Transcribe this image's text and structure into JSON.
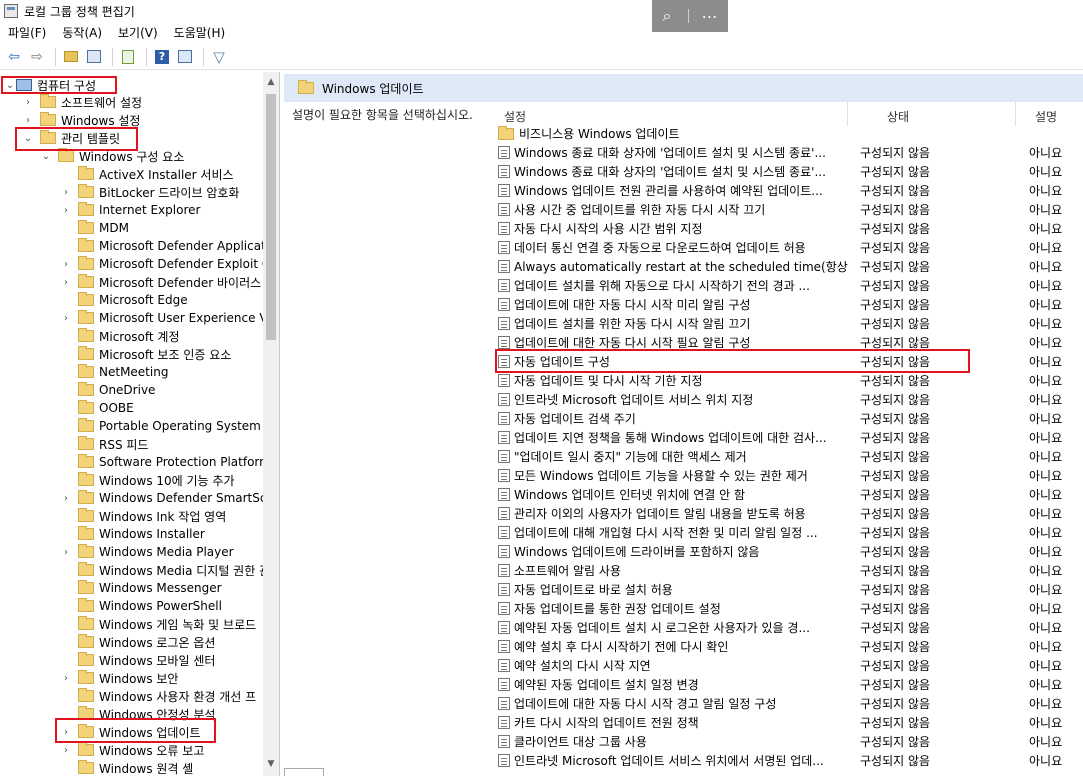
{
  "window": {
    "title": "로컬 그룹 정책 편집기"
  },
  "menu": [
    "파일(F)",
    "동작(A)",
    "보기(V)",
    "도움말(H)"
  ],
  "toolbar": {
    "icons": [
      "back-arrow-icon",
      "forward-arrow-icon",
      "up-folder-icon",
      "show-hide-tree-icon",
      "export-list-icon",
      "help-icon",
      "properties-icon",
      "filter-icon"
    ]
  },
  "tree": {
    "root": "컴퓨터 구성",
    "software_settings": "소프트웨어 설정",
    "windows_settings": "Windows 설정",
    "admin_templates": "관리 템플릿",
    "windows_components": "Windows 구성 요소",
    "items": [
      {
        "label": "ActiveX Installer 서비스",
        "expandable": false
      },
      {
        "label": "BitLocker 드라이브 암호화",
        "expandable": true
      },
      {
        "label": "Internet Explorer",
        "expandable": true
      },
      {
        "label": "MDM",
        "expandable": false
      },
      {
        "label": "Microsoft Defender Applicatio",
        "expandable": false
      },
      {
        "label": "Microsoft Defender Exploit Gu",
        "expandable": true
      },
      {
        "label": "Microsoft Defender 바이러스 ",
        "expandable": true
      },
      {
        "label": "Microsoft Edge",
        "expandable": false
      },
      {
        "label": "Microsoft User Experience Virt",
        "expandable": true
      },
      {
        "label": "Microsoft 계정",
        "expandable": false
      },
      {
        "label": "Microsoft 보조 인증 요소",
        "expandable": false
      },
      {
        "label": "NetMeeting",
        "expandable": false
      },
      {
        "label": "OneDrive",
        "expandable": false
      },
      {
        "label": "OOBE",
        "expandable": false
      },
      {
        "label": "Portable Operating System",
        "expandable": false
      },
      {
        "label": "RSS 피드",
        "expandable": false
      },
      {
        "label": "Software Protection Platform",
        "expandable": false
      },
      {
        "label": "Windows 10에 기능 추가",
        "expandable": false
      },
      {
        "label": "Windows Defender SmartScre",
        "expandable": true
      },
      {
        "label": "Windows Ink 작업 영역",
        "expandable": false
      },
      {
        "label": "Windows Installer",
        "expandable": false
      },
      {
        "label": "Windows Media Player",
        "expandable": true
      },
      {
        "label": "Windows Media 디지털 권한 관",
        "expandable": false
      },
      {
        "label": "Windows Messenger",
        "expandable": false
      },
      {
        "label": "Windows PowerShell",
        "expandable": false
      },
      {
        "label": "Windows 게임 녹화 및 브로드",
        "expandable": false
      },
      {
        "label": "Windows 로그온 옵션",
        "expandable": false
      },
      {
        "label": "Windows 모바일 센터",
        "expandable": false
      },
      {
        "label": "Windows 보안",
        "expandable": true
      },
      {
        "label": "Windows 사용자 환경 개선 프",
        "expandable": false
      },
      {
        "label": "Windows 안정성 분석",
        "expandable": false
      },
      {
        "label": "Windows 업데이트",
        "expandable": true
      },
      {
        "label": "Windows 오류 보고",
        "expandable": true
      },
      {
        "label": "Windows 원격 셸",
        "expandable": false
      }
    ]
  },
  "right": {
    "header": "Windows 업데이트",
    "description": "설명이 필요한 항목을 선택하십시오.",
    "columns": {
      "setting": "설정",
      "state": "상태",
      "comment": "설명"
    },
    "folder_row": "비즈니스용 Windows 업데이트",
    "rows": [
      {
        "name": "Windows 종료 대화 상자에 '업데이트 설치 및 시스템 종료'...",
        "state": "구성되지 않음",
        "comment": "아니요"
      },
      {
        "name": "Windows 종료 대화 상자의 '업데이트 설치 및 시스템 종료'...",
        "state": "구성되지 않음",
        "comment": "아니요"
      },
      {
        "name": "Windows 업데이트 전원 관리를 사용하여 예약된 업데이트...",
        "state": "구성되지 않음",
        "comment": "아니요"
      },
      {
        "name": "사용 시간 중 업데이트를 위한 자동 다시 시작 끄기",
        "state": "구성되지 않음",
        "comment": "아니요"
      },
      {
        "name": "자동 다시 시작의 사용 시간 범위 지정",
        "state": "구성되지 않음",
        "comment": "아니요"
      },
      {
        "name": "데이터 통신 연결 중 자동으로 다운로드하여 업데이트 허용",
        "state": "구성되지 않음",
        "comment": "아니요"
      },
      {
        "name": "Always automatically restart at the scheduled time(항상 예...",
        "state": "구성되지 않음",
        "comment": "아니요"
      },
      {
        "name": "업데이트 설치를 위해 자동으로 다시 시작하기 전의 경과 ...",
        "state": "구성되지 않음",
        "comment": "아니요"
      },
      {
        "name": "업데이트에 대한 자동 다시 시작 미리 알림 구성",
        "state": "구성되지 않음",
        "comment": "아니요"
      },
      {
        "name": "업데이트 설치를 위한 자동 다시 시작 알림 끄기",
        "state": "구성되지 않음",
        "comment": "아니요"
      },
      {
        "name": "업데이트에 대한 자동 다시 시작 필요 알림 구성",
        "state": "구성되지 않음",
        "comment": "아니요"
      },
      {
        "name": "자동 업데이트 구성",
        "state": "구성되지 않음",
        "comment": "아니요"
      },
      {
        "name": "자동 업데이트 및 다시 시작 기한 지정",
        "state": "구성되지 않음",
        "comment": "아니요"
      },
      {
        "name": "인트라넷 Microsoft 업데이트 서비스 위치 지정",
        "state": "구성되지 않음",
        "comment": "아니요"
      },
      {
        "name": "자동 업데이트 검색 주기",
        "state": "구성되지 않음",
        "comment": "아니요"
      },
      {
        "name": "업데이트 지연 정책을 통해 Windows 업데이트에 대한 검사...",
        "state": "구성되지 않음",
        "comment": "아니요"
      },
      {
        "name": "\"업데이트 일시 중지\" 기능에 대한 액세스 제거",
        "state": "구성되지 않음",
        "comment": "아니요"
      },
      {
        "name": "모든 Windows 업데이트 기능을 사용할 수 있는 권한 제거",
        "state": "구성되지 않음",
        "comment": "아니요"
      },
      {
        "name": "Windows 업데이트 인터넷 위치에 연결 안 함",
        "state": "구성되지 않음",
        "comment": "아니요"
      },
      {
        "name": "관리자 이외의 사용자가 업데이트 알림 내용을 받도록 허용",
        "state": "구성되지 않음",
        "comment": "아니요"
      },
      {
        "name": "업데이트에 대해 개입형 다시 시작 전환 및 미리 알림 일정 ...",
        "state": "구성되지 않음",
        "comment": "아니요"
      },
      {
        "name": "Windows 업데이트에 드라이버를 포함하지 않음",
        "state": "구성되지 않음",
        "comment": "아니요"
      },
      {
        "name": "소프트웨어 알림 사용",
        "state": "구성되지 않음",
        "comment": "아니요"
      },
      {
        "name": "자동 업데이트로 바로 설치 허용",
        "state": "구성되지 않음",
        "comment": "아니요"
      },
      {
        "name": "자동 업데이트를 통한 권장 업데이트 설정",
        "state": "구성되지 않음",
        "comment": "아니요"
      },
      {
        "name": "예약된 자동 업데이트 설치 시 로그온한 사용자가 있을 경...",
        "state": "구성되지 않음",
        "comment": "아니요"
      },
      {
        "name": "예약 설치 후 다시 시작하기 전에 다시 확인",
        "state": "구성되지 않음",
        "comment": "아니요"
      },
      {
        "name": "예약 설치의 다시 시작 지연",
        "state": "구성되지 않음",
        "comment": "아니요"
      },
      {
        "name": "예약된 자동 업데이트 설치 일정 변경",
        "state": "구성되지 않음",
        "comment": "아니요"
      },
      {
        "name": "업데이트에 대한 자동 다시 시작 경고 알림 일정 구성",
        "state": "구성되지 않음",
        "comment": "아니요"
      },
      {
        "name": "카트 다시 시작의 업데이트 전원 정책",
        "state": "구성되지 않음",
        "comment": "아니요"
      },
      {
        "name": "클라이언트 대상 그룹 사용",
        "state": "구성되지 않음",
        "comment": "아니요"
      },
      {
        "name": "인트라넷 Microsoft 업데이트 서비스 위치에서 서명된 업데...",
        "state": "구성되지 않음",
        "comment": "아니요"
      }
    ]
  },
  "highlight_color": "#e0141e"
}
